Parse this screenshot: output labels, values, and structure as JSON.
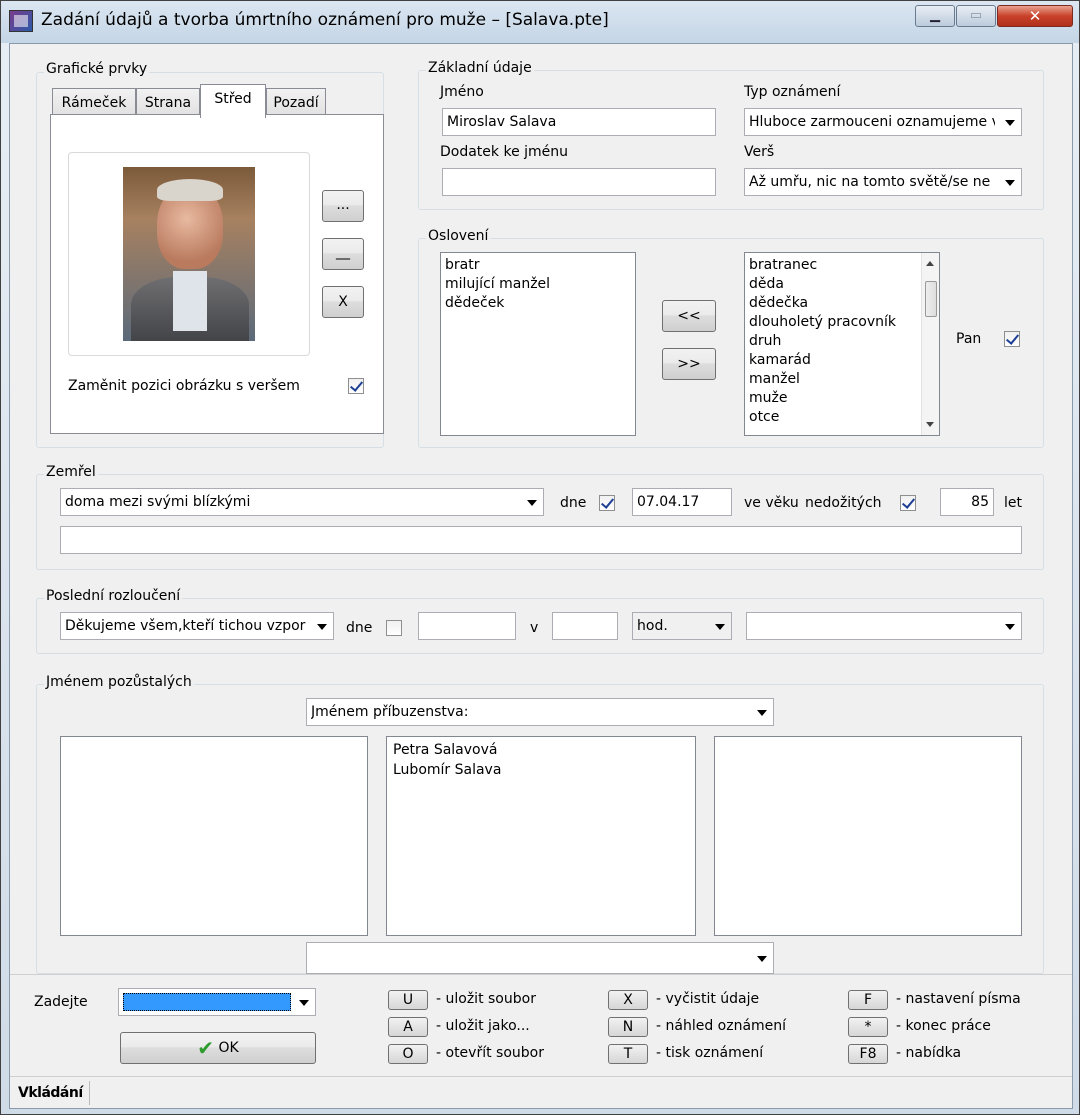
{
  "window": {
    "title": "Zadání údajů a tvorba úmrtního oznámení pro muže – [Salava.pte]"
  },
  "titlebar_buttons": {
    "minimize": "▁",
    "maximize": "▭",
    "close": "✕"
  },
  "graficke": {
    "label": "Grafické prvky",
    "tabs": [
      "Rámeček",
      "Strana",
      "Střed",
      "Pozadí"
    ],
    "active_tab": "Střed",
    "buttons": {
      "browse": "...",
      "clear": "__",
      "remove": "X"
    },
    "swap_label": "Zaměnit pozici obrázku s veršem",
    "swap_checked": true
  },
  "zakladni": {
    "label": "Základní údaje",
    "jmeno_label": "Jméno",
    "jmeno_value": "Miroslav Salava",
    "dodatek_label": "Dodatek ke jménu",
    "dodatek_value": "",
    "typ_label": "Typ oznámení",
    "typ_value": "Hluboce zarmouceni oznamujeme v",
    "vers_label": "Verš",
    "vers_value": "Až umřu, nic na tomto světě/se ne"
  },
  "osloveni": {
    "label": "Oslovení",
    "selected": [
      "bratr",
      "milující manžel",
      "dědeček"
    ],
    "available": [
      "bratranec",
      "děda",
      "dědečka",
      "dlouholetý pracovník",
      "druh",
      "kamarád",
      "manžel",
      "muže",
      "otce"
    ],
    "btn_add": "<<",
    "btn_remove": ">>",
    "pan_label": "Pan",
    "pan_checked": true
  },
  "zemrel": {
    "label": "Zemřel",
    "misto_value": "doma mezi svými blízkými",
    "dne_label": "dne",
    "dne_checked": true,
    "datum_value": "07.04.17",
    "vek_label": "ve věku",
    "nedozitych_label": "nedožitých",
    "nedozitych_checked": true,
    "vek_value": "85",
    "let_label": "let",
    "poznamka_value": ""
  },
  "rozlouceni": {
    "label": "Poslední rozloučení",
    "text_value": "Děkujeme všem,kteří tichou vzpor",
    "dne_label": "dne",
    "dne_checked": false,
    "datum_value": "",
    "v_label": "v",
    "cas_value": "",
    "hod_value": "hod.",
    "misto_value": ""
  },
  "pozustali": {
    "label": "Jménem pozůstalých",
    "header_value": "Jménem příbuzenstva:",
    "left_list": [],
    "middle_list": [
      "Petra Salavová",
      "Lubomír Salava"
    ],
    "right_list": [],
    "footer_value": ""
  },
  "bottom": {
    "zadejte_label": "Zadejte",
    "ok_label": "OK",
    "shortcuts": [
      {
        "key": "U",
        "desc": "- uložit soubor"
      },
      {
        "key": "A",
        "desc": "- uložit jako..."
      },
      {
        "key": "O",
        "desc": "- otevřít soubor"
      },
      {
        "key": "X",
        "desc": "- vyčistit údaje"
      },
      {
        "key": "N",
        "desc": "- náhled oznámení"
      },
      {
        "key": "T",
        "desc": "- tisk oznámení"
      },
      {
        "key": "F",
        "desc": "- nastavení písma"
      },
      {
        "key": "*",
        "desc": "- konec práce"
      },
      {
        "key": "F8",
        "desc": "- nabídka"
      }
    ]
  },
  "status": {
    "text": "Vkládání"
  },
  "colors": {
    "accent": "#3399ff",
    "check": "#1c3f94",
    "close": "#c9412a",
    "ok_check": "#2e9b2e"
  }
}
